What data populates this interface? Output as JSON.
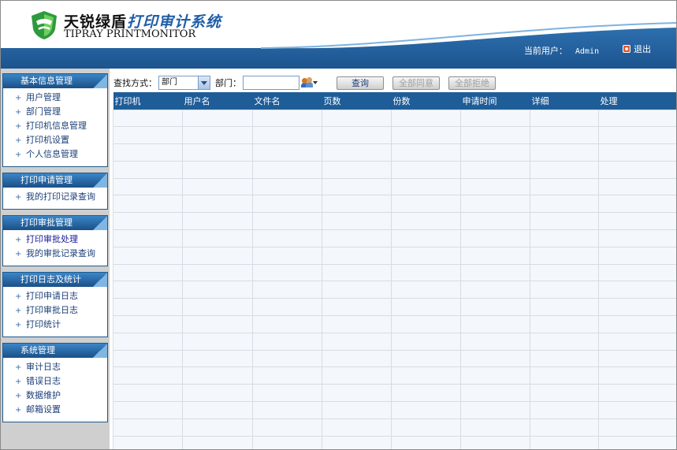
{
  "header": {
    "brand_cn_black": "天锐绿盾",
    "brand_cn_blue": "打印审计系统",
    "brand_en": "TIPRAY PRINTMONITOR",
    "current_user_label": "当前用户：",
    "current_user": "Admin",
    "logout": "退出"
  },
  "sidebar": [
    {
      "title": "基本信息管理",
      "items": [
        "用户管理",
        "部门管理",
        "打印机信息管理",
        "打印机设置",
        "个人信息管理"
      ]
    },
    {
      "title": "打印申请管理",
      "items": [
        "我的打印记录查询"
      ]
    },
    {
      "title": "打印审批管理",
      "items": [
        "打印审批处理",
        "我的审批记录查询"
      ]
    },
    {
      "title": "打印日志及统计",
      "items": [
        "打印申请日志",
        "打印审批日志",
        "打印统计"
      ]
    },
    {
      "title": "系统管理",
      "items": [
        "审计日志",
        "错误日志",
        "数据维护",
        "邮箱设置"
      ]
    }
  ],
  "toolbar": {
    "search_mode_label": "查找方式：",
    "search_mode_value": "部门",
    "dept_label": "部门：",
    "query": "查询",
    "all_agree": "全部同意",
    "all_reject": "全部拒绝"
  },
  "table": {
    "columns": [
      "打印机",
      "用户名",
      "文件名",
      "页数",
      "份数",
      "申请时间",
      "详细",
      "处理"
    ]
  },
  "colors": {
    "header_blue": "#1f5d98",
    "row_bg": "#f4f8fd"
  }
}
